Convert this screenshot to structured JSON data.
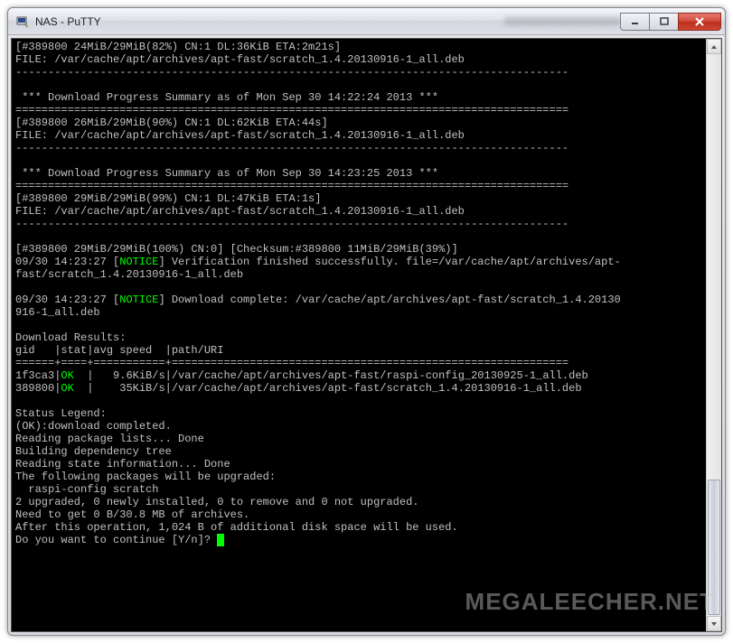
{
  "window": {
    "title": "NAS - PuTTY",
    "blurred": "XXXXXXXXXXXXXXXX"
  },
  "terminal": {
    "l01": "[#389800 24MiB/29MiB(82%) CN:1 DL:36KiB ETA:2m21s]",
    "l02": "FILE: /var/cache/apt/archives/apt-fast/scratch_1.4.20130916-1_all.deb",
    "l03": "-------------------------------------------------------------------------------------",
    "l04": "",
    "l05": " *** Download Progress Summary as of Mon Sep 30 14:22:24 2013 ***",
    "l06": "=====================================================================================",
    "l07": "[#389800 26MiB/29MiB(90%) CN:1 DL:62KiB ETA:44s]",
    "l08": "FILE: /var/cache/apt/archives/apt-fast/scratch_1.4.20130916-1_all.deb",
    "l09": "-------------------------------------------------------------------------------------",
    "l10": "",
    "l11": " *** Download Progress Summary as of Mon Sep 30 14:23:25 2013 ***",
    "l12": "=====================================================================================",
    "l13": "[#389800 29MiB/29MiB(99%) CN:1 DL:47KiB ETA:1s]",
    "l14": "FILE: /var/cache/apt/archives/apt-fast/scratch_1.4.20130916-1_all.deb",
    "l15": "-------------------------------------------------------------------------------------",
    "l16": "",
    "l17": "[#389800 29MiB/29MiB(100%) CN:0] [Checksum:#389800 11MiB/29MiB(39%)]",
    "l18a": "09/30 14:23:27 [",
    "l18b": "NOTICE",
    "l18c": "] Verification finished successfully. file=/var/cache/apt/archives/apt-",
    "l19": "fast/scratch_1.4.20130916-1_all.deb",
    "l20": "",
    "l21a": "09/30 14:23:27 [",
    "l21b": "NOTICE",
    "l21c": "] Download complete: /var/cache/apt/archives/apt-fast/scratch_1.4.20130",
    "l22": "916-1_all.deb",
    "l23": "",
    "l24": "Download Results:",
    "l25": "gid   |stat|avg speed  |path/URI",
    "l26": "======+====+===========+=============================================================",
    "l27a": "1f3ca3|",
    "l27b": "OK",
    "l27c": "  |   9.6KiB/s|/var/cache/apt/archives/apt-fast/raspi-config_20130925-1_all.deb",
    "l28a": "389800|",
    "l28b": "OK",
    "l28c": "  |    35KiB/s|/var/cache/apt/archives/apt-fast/scratch_1.4.20130916-1_all.deb",
    "l29": "",
    "l30": "Status Legend:",
    "l31": "(OK):download completed.",
    "l32": "Reading package lists... Done",
    "l33": "Building dependency tree",
    "l34": "Reading state information... Done",
    "l35": "The following packages will be upgraded:",
    "l36": "  raspi-config scratch",
    "l37": "2 upgraded, 0 newly installed, 0 to remove and 0 not upgraded.",
    "l38": "Need to get 0 B/30.8 MB of archives.",
    "l39": "After this operation, 1,024 B of additional disk space will be used.",
    "l40": "Do you want to continue [Y/n]? "
  },
  "watermark": "MEGALEECHER.NET"
}
